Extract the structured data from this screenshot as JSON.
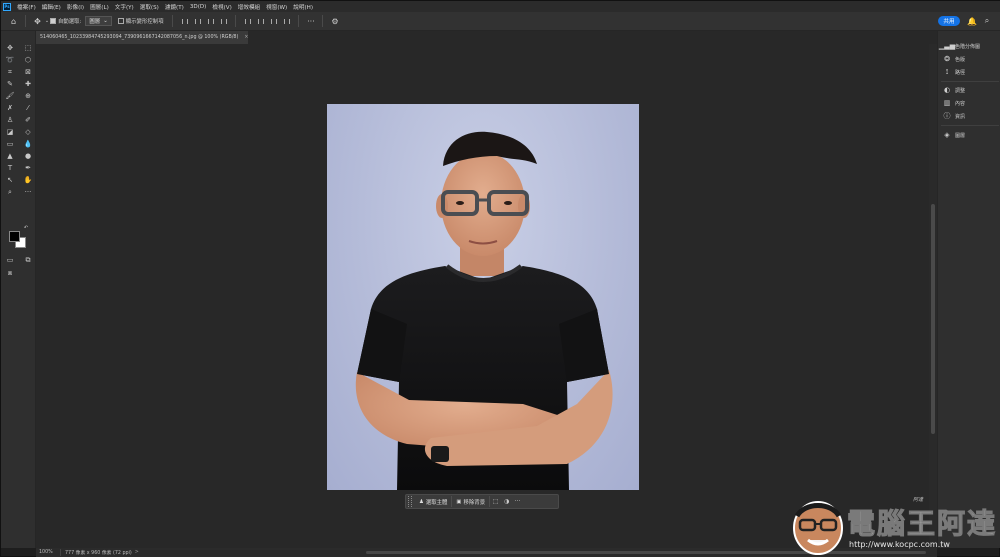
{
  "menubar": {
    "logo": "Ps",
    "items": [
      "檔案(F)",
      "編輯(E)",
      "影像(I)",
      "圖層(L)",
      "文字(Y)",
      "選取(S)",
      "濾鏡(T)",
      "3D(D)",
      "檢視(V)",
      "增效模組",
      "視窗(W)",
      "說明(H)"
    ]
  },
  "options": {
    "auto_select_label": "自動選取:",
    "layer_select_value": "圖層",
    "transform_label": "顯示變形控制項",
    "share_label": "共用"
  },
  "document": {
    "tab_title": "514060465_10233984745293094_7390961667142087056_n.jpg @ 100% (RGB/8)"
  },
  "right_panel": {
    "items": [
      "色階分佈圖",
      "色版",
      "路徑",
      "調整",
      "內容",
      "資訊",
      "圖層"
    ]
  },
  "contextual_bar": {
    "select_subject_label": "選取主體",
    "remove_bg_label": "移除背景"
  },
  "status": {
    "zoom": "100%",
    "doc_info": "777 像素 x 960 像素 (72 ppi)",
    "more": ">"
  },
  "watermark": {
    "brand": "電腦王阿達",
    "url": "http://www.kocpc.com.tw",
    "signature": "阿達"
  },
  "colors": {
    "accent": "#1473e6",
    "workspace": "#282828",
    "panel": "#2f2f2f"
  }
}
